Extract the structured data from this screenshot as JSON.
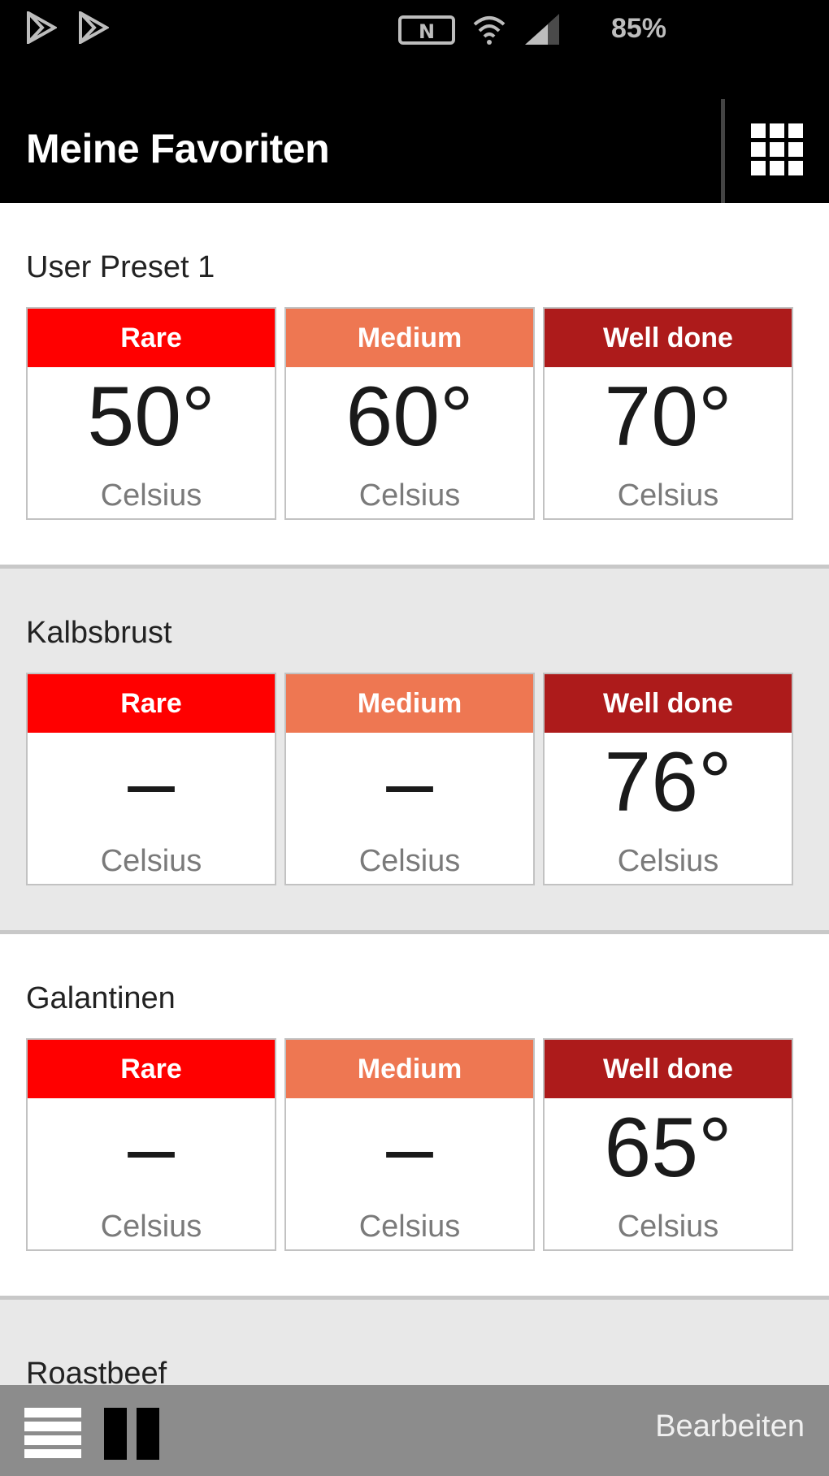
{
  "status_bar": {
    "battery": "85%",
    "left_icons": [
      "play-store-icon",
      "play-store-icon"
    ],
    "right_icons": [
      "nfc-icon",
      "wifi-icon",
      "signal-icon"
    ]
  },
  "app_bar": {
    "title": "Meine Favoriten",
    "grid_icon": "grid-icon"
  },
  "sections": [
    {
      "title": "User Preset 1",
      "cards": [
        {
          "label": "Rare",
          "value": "50°",
          "unit": "Celsius"
        },
        {
          "label": "Medium",
          "value": "60°",
          "unit": "Celsius"
        },
        {
          "label": "Well done",
          "value": "70°",
          "unit": "Celsius"
        }
      ]
    },
    {
      "title": "Kalbsbrust",
      "cards": [
        {
          "label": "Rare",
          "value": "–",
          "unit": "Celsius"
        },
        {
          "label": "Medium",
          "value": "–",
          "unit": "Celsius"
        },
        {
          "label": "Well done",
          "value": "76°",
          "unit": "Celsius"
        }
      ]
    },
    {
      "title": "Galantinen",
      "cards": [
        {
          "label": "Rare",
          "value": "–",
          "unit": "Celsius"
        },
        {
          "label": "Medium",
          "value": "–",
          "unit": "Celsius"
        },
        {
          "label": "Well done",
          "value": "65°",
          "unit": "Celsius"
        }
      ]
    },
    {
      "title": "Roastbeef"
    }
  ],
  "bottom_bar": {
    "edit_label": "Bearbeiten",
    "list_icon": "list-view-icon",
    "column_icon": "column-view-icon"
  },
  "colors": {
    "rare": "#ff0000",
    "medium": "#ee7752",
    "well_done": "#ad1b1b",
    "app_bar": "#000000",
    "bottom_bar": "#8c8c8c"
  }
}
